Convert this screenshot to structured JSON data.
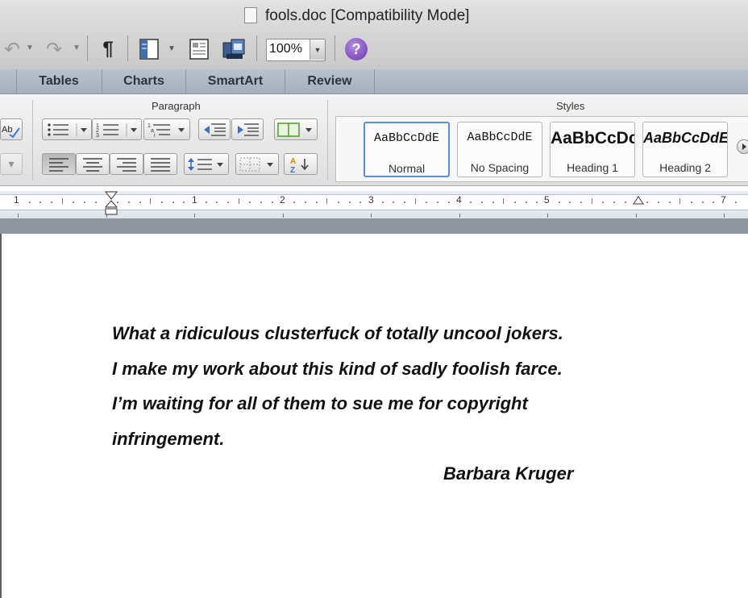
{
  "window": {
    "title": "fools.doc [Compatibility Mode]"
  },
  "toolbar": {
    "undo_icon": "undo-icon",
    "redo_icon": "redo-icon",
    "pilcrow": "¶",
    "zoom": "100%",
    "help": "?"
  },
  "ribbon_tabs": [
    "Tables",
    "Charts",
    "SmartArt",
    "Review"
  ],
  "groups": {
    "paragraph": "Paragraph",
    "styles": "Styles"
  },
  "styles": [
    {
      "preview": "AaBbCcDdE",
      "name": "Normal"
    },
    {
      "preview": "AaBbCcDdE",
      "name": "No Spacing"
    },
    {
      "preview": "AaBbCcDc",
      "name": "Heading 1"
    },
    {
      "preview": "AaBbCcDdE",
      "name": "Heading 2"
    }
  ],
  "ruler": [
    "1",
    "1",
    "2",
    "3",
    "4",
    "5",
    "7"
  ],
  "document": {
    "lines": [
      "What a ridiculous clusterfuck of totally uncool jokers.",
      "I make my work about this kind of sadly foolish farce.",
      "I’m waiting for all of them to sue me for copyright",
      "infringement."
    ],
    "author": "Barbara Kruger"
  },
  "colors": {
    "selected_style_border": "#5b8fd3",
    "help_button": "#6a34b0",
    "tabs_bar": "#aab4c1"
  }
}
